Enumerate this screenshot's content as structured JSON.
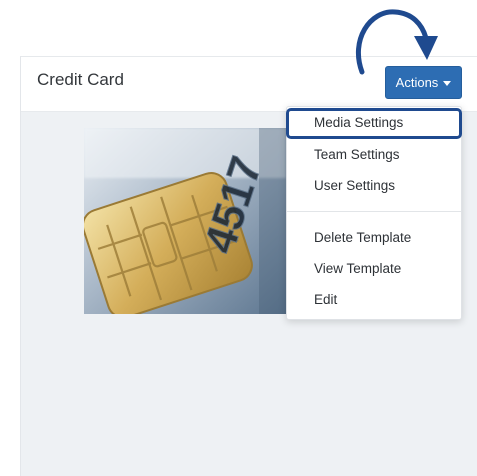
{
  "panel": {
    "title": "Credit Card"
  },
  "actions": {
    "label": "Actions"
  },
  "dropdown": {
    "group1": [
      "Media Settings",
      "Team Settings",
      "User Settings"
    ],
    "group2": [
      "Delete Template",
      "View Template",
      "Edit"
    ],
    "highlighted": "Media Settings"
  },
  "image": {
    "card_digits": "4517"
  },
  "colors": {
    "button": "#2d6db3",
    "highlight": "#1f4a8f",
    "panel_bg": "#eef1f4"
  }
}
